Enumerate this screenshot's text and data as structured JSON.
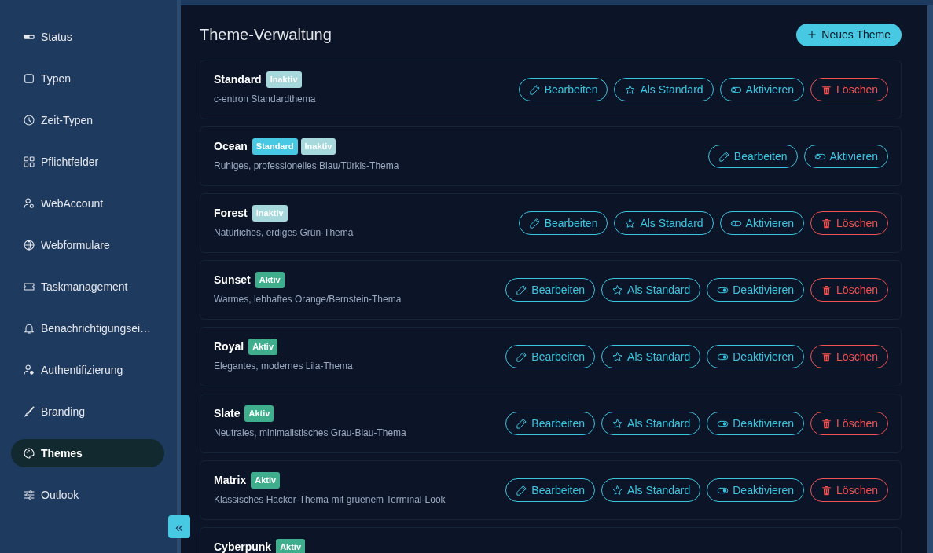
{
  "sidebar": {
    "items": [
      {
        "label": "Status",
        "selected": false
      },
      {
        "label": "Typen",
        "selected": false
      },
      {
        "label": "Zeit-Typen",
        "selected": false
      },
      {
        "label": "Pflichtfelder",
        "selected": false
      },
      {
        "label": "WebAccount",
        "selected": false
      },
      {
        "label": "Webformulare",
        "selected": false
      },
      {
        "label": "Taskmanagement",
        "selected": false
      },
      {
        "label": "Benachrichtigungsei…",
        "selected": false
      },
      {
        "label": "Authentifizierung",
        "selected": false
      },
      {
        "label": "Branding",
        "selected": false
      },
      {
        "label": "Themes",
        "selected": true
      },
      {
        "label": "Outlook",
        "selected": false
      }
    ],
    "collapse_button": "«"
  },
  "page": {
    "title": "Theme-Verwaltung",
    "new_button": "Neues Theme"
  },
  "themes": [
    {
      "name": "Standard",
      "description": "c-entron Standardthema",
      "badges": [
        {
          "kind": "inactive",
          "label": "Inaktiv"
        }
      ],
      "actions": [
        {
          "kind": "edit",
          "label": "Bearbeiten"
        },
        {
          "kind": "default",
          "label": "Als Standard"
        },
        {
          "kind": "activate",
          "label": "Aktivieren"
        },
        {
          "kind": "delete",
          "label": "Löschen"
        }
      ]
    },
    {
      "name": "Ocean",
      "description": "Ruhiges, professionelles Blau/Türkis-Thema",
      "badges": [
        {
          "kind": "standard",
          "label": "Standard"
        },
        {
          "kind": "inactive",
          "label": "Inaktiv"
        }
      ],
      "actions": [
        {
          "kind": "edit",
          "label": "Bearbeiten"
        },
        {
          "kind": "activate",
          "label": "Aktivieren"
        }
      ]
    },
    {
      "name": "Forest",
      "description": "Natürliches, erdiges Grün-Thema",
      "badges": [
        {
          "kind": "inactive",
          "label": "Inaktiv"
        }
      ],
      "actions": [
        {
          "kind": "edit",
          "label": "Bearbeiten"
        },
        {
          "kind": "default",
          "label": "Als Standard"
        },
        {
          "kind": "activate",
          "label": "Aktivieren"
        },
        {
          "kind": "delete",
          "label": "Löschen"
        }
      ]
    },
    {
      "name": "Sunset",
      "description": "Warmes, lebhaftes Orange/Bernstein-Thema",
      "badges": [
        {
          "kind": "active",
          "label": "Aktiv"
        }
      ],
      "actions": [
        {
          "kind": "edit",
          "label": "Bearbeiten"
        },
        {
          "kind": "default",
          "label": "Als Standard"
        },
        {
          "kind": "deactivate",
          "label": "Deaktivieren"
        },
        {
          "kind": "delete",
          "label": "Löschen"
        }
      ]
    },
    {
      "name": "Royal",
      "description": "Elegantes, modernes Lila-Thema",
      "badges": [
        {
          "kind": "active",
          "label": "Aktiv"
        }
      ],
      "actions": [
        {
          "kind": "edit",
          "label": "Bearbeiten"
        },
        {
          "kind": "default",
          "label": "Als Standard"
        },
        {
          "kind": "deactivate",
          "label": "Deaktivieren"
        },
        {
          "kind": "delete",
          "label": "Löschen"
        }
      ]
    },
    {
      "name": "Slate",
      "description": "Neutrales, minimalistisches Grau-Blau-Thema",
      "badges": [
        {
          "kind": "active",
          "label": "Aktiv"
        }
      ],
      "actions": [
        {
          "kind": "edit",
          "label": "Bearbeiten"
        },
        {
          "kind": "default",
          "label": "Als Standard"
        },
        {
          "kind": "deactivate",
          "label": "Deaktivieren"
        },
        {
          "kind": "delete",
          "label": "Löschen"
        }
      ]
    },
    {
      "name": "Matrix",
      "description": "Klassisches Hacker-Thema mit gruenem Terminal-Look",
      "badges": [
        {
          "kind": "active",
          "label": "Aktiv"
        }
      ],
      "actions": [
        {
          "kind": "edit",
          "label": "Bearbeiten"
        },
        {
          "kind": "default",
          "label": "Als Standard"
        },
        {
          "kind": "deactivate",
          "label": "Deaktivieren"
        },
        {
          "kind": "delete",
          "label": "Löschen"
        }
      ]
    },
    {
      "name": "Cyberpunk",
      "badges": [
        {
          "kind": "active",
          "label": "Aktiv"
        }
      ]
    }
  ]
}
